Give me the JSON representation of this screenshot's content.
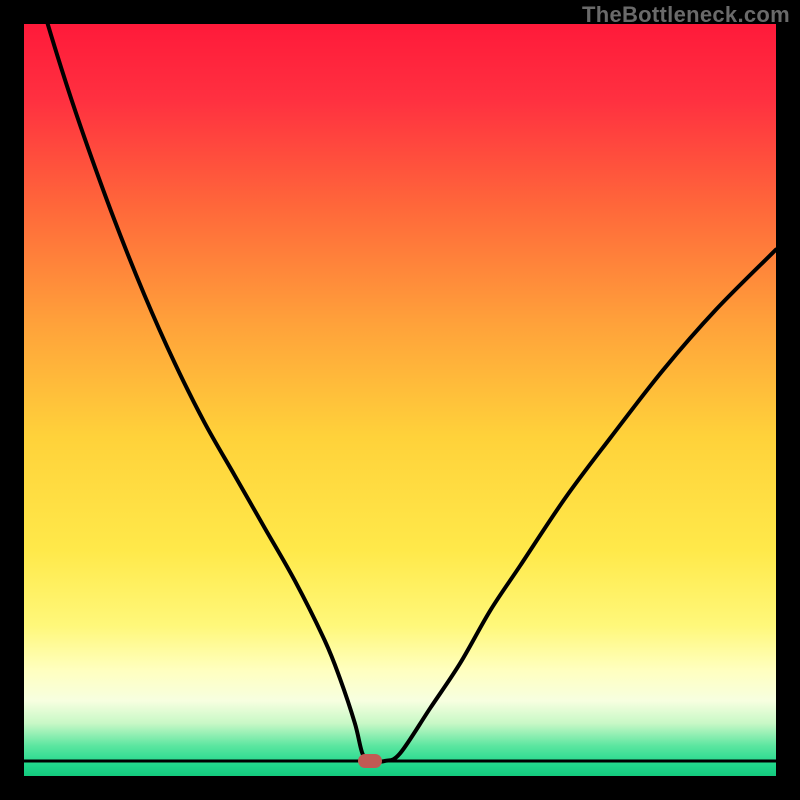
{
  "watermark": "TheBottleneck.com",
  "colors": {
    "frame": "#000000",
    "curve": "#000000",
    "marker": "#c25a54",
    "gradient_stops": [
      {
        "offset": 0.0,
        "color": "#ff1a3a"
      },
      {
        "offset": 0.1,
        "color": "#ff3040"
      },
      {
        "offset": 0.25,
        "color": "#ff6a3a"
      },
      {
        "offset": 0.4,
        "color": "#ffa23a"
      },
      {
        "offset": 0.55,
        "color": "#ffd23a"
      },
      {
        "offset": 0.7,
        "color": "#ffe94a"
      },
      {
        "offset": 0.8,
        "color": "#fff87a"
      },
      {
        "offset": 0.86,
        "color": "#ffffc0"
      },
      {
        "offset": 0.9,
        "color": "#f7ffe0"
      },
      {
        "offset": 0.93,
        "color": "#c8f8c6"
      },
      {
        "offset": 0.96,
        "color": "#5be6a0"
      },
      {
        "offset": 0.985,
        "color": "#20d88c"
      },
      {
        "offset": 1.0,
        "color": "#14c97e"
      }
    ]
  },
  "chart_data": {
    "type": "line",
    "title": "",
    "xlabel": "",
    "ylabel": "",
    "xlim": [
      0,
      100
    ],
    "ylim": [
      0,
      100
    ],
    "grid": false,
    "legend": false,
    "marker": {
      "x": 46,
      "y": 2
    },
    "series": [
      {
        "name": "bottleneck-curve",
        "x": [
          0,
          2,
          5,
          8,
          12,
          16,
          20,
          24,
          28,
          32,
          36,
          40,
          42,
          44,
          45,
          46,
          48,
          50,
          54,
          58,
          62,
          66,
          72,
          78,
          85,
          92,
          100
        ],
        "y": [
          112,
          104,
          94,
          85,
          74,
          64,
          55,
          47,
          40,
          33,
          26,
          18,
          13,
          7,
          3,
          2,
          2,
          3,
          9,
          15,
          22,
          28,
          37,
          45,
          54,
          62,
          70
        ]
      },
      {
        "name": "baseline",
        "x": [
          0,
          100
        ],
        "y": [
          2,
          2
        ]
      }
    ]
  }
}
